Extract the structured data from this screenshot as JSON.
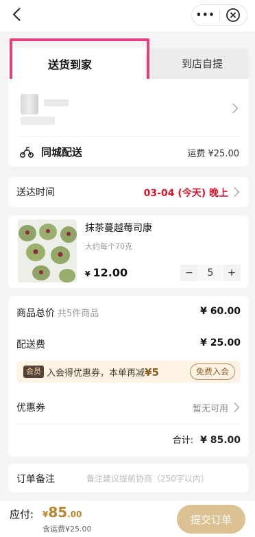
{
  "nav": {
    "back": "back-arrow",
    "more": "•••"
  },
  "tabs": {
    "active": "送货到家",
    "inactive": "到店自提"
  },
  "delivery": {
    "title": "同城配送",
    "fee": "运费 ¥25.00"
  },
  "time": {
    "label": "送达时间",
    "value": "03-04 (今天) 晚上"
  },
  "product": {
    "name": "抹茶蔓越莓司康",
    "spec": "大约每个70克",
    "currency": "¥",
    "price": "12.00",
    "quantity": "5",
    "minus": "−",
    "plus": "+"
  },
  "summary": {
    "goods_label": "商品总价",
    "goods_sub": "共5件商品",
    "goods_value": "¥ 60.00",
    "shipping_label": "配送费",
    "shipping_value": "¥ 25.00",
    "member_badge": "会员",
    "member_text": "入会得优惠券，本单再减",
    "member_amount": "¥5",
    "member_join": "免费入会",
    "coupon_label": "优惠券",
    "coupon_value": "暂无可用",
    "total_label": "合计:",
    "total_value": "¥ 85.00"
  },
  "note": {
    "label": "订单备注",
    "placeholder": "备注建议提前协商（250字以内）"
  },
  "bottom": {
    "pay_label": "应付:",
    "currency": "¥",
    "amount_int": "85",
    "amount_dec": ".00",
    "sub": "含运费¥25.00",
    "submit": "提交订单"
  },
  "colors": {
    "accent": "#d8172b",
    "gold": "#b8862f",
    "submit_bg": "#dcc293",
    "highlight": "#e0407c"
  }
}
